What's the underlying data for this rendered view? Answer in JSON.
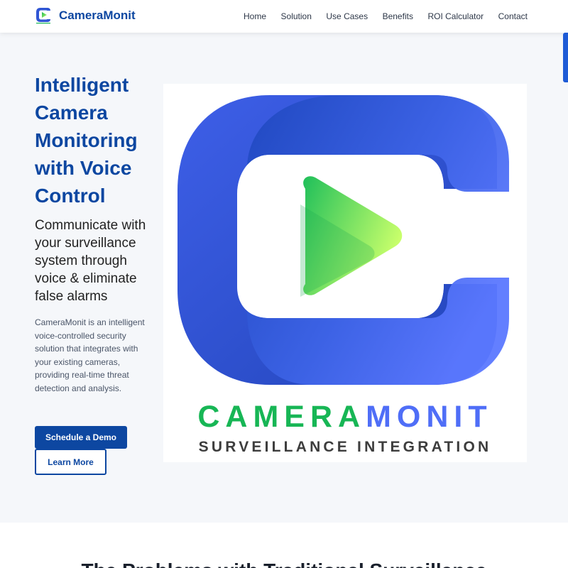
{
  "brand": {
    "name": "CameraMonit"
  },
  "nav": {
    "items": [
      "Home",
      "Solution",
      "Use Cases",
      "Benefits",
      "ROI Calculator",
      "Contact"
    ]
  },
  "hero": {
    "title": "Intelligent Camera Monitoring with Voice Control",
    "subtitle": "Communicate with your surveillance system through voice & eliminate false alarms",
    "description": "CameraMonit is an intelligent voice-controlled security solution that integrates with your existing cameras, providing real-time threat detection and analysis.",
    "primary_button": "Schedule a Demo",
    "secondary_button": "Learn More",
    "logo": {
      "wordmark_part1": "CAMERA",
      "wordmark_part2": "MONIT",
      "tagline": "SURVEILLANCE INTEGRATION",
      "icon": "camera-play-icon"
    }
  },
  "problems": {
    "title": "The Problems with Traditional Surveillance"
  },
  "colors": {
    "primary": "#0d47a1",
    "brand_blue": "#4f6ef7",
    "brand_green": "#17b655",
    "hero_bg": "#f5f7fa"
  }
}
